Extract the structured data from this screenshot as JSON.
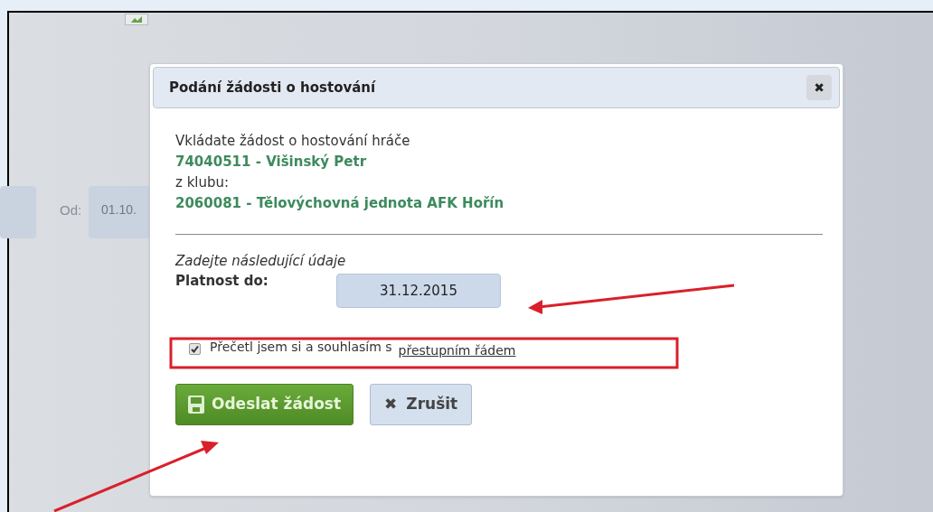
{
  "background": {
    "date_label": "Od:",
    "date_value": "01.10."
  },
  "dialog": {
    "title": "Podání žádosti o hostování",
    "close": "✖",
    "intro": "Vkládate žádost o hostování hráče",
    "player": "74040511 - Višinský Petr",
    "from_label": "z klubu:",
    "club": "2060081 - Tělovýchovná jednota AFK Hořín",
    "section_hint": "Zadejte následující údaje",
    "valid_label": "Platnost do:",
    "valid_value": "31.12.2015",
    "agreement": {
      "checked": true,
      "text": "Přečetl jsem si a souhlasím s",
      "link": "přestupním řádem"
    },
    "submit": "Odeslat žádost",
    "cancel": "Zrušit",
    "cancel_icon": "✖"
  }
}
